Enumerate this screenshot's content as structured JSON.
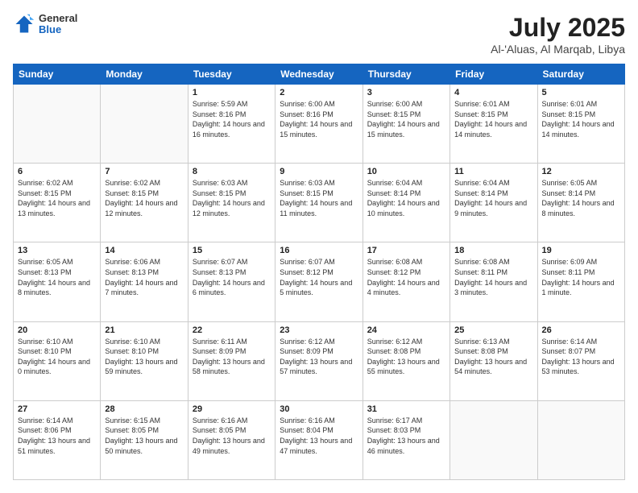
{
  "header": {
    "logo_general": "General",
    "logo_blue": "Blue",
    "month_year": "July 2025",
    "location": "Al-'Aluas, Al Marqab, Libya"
  },
  "days_of_week": [
    "Sunday",
    "Monday",
    "Tuesday",
    "Wednesday",
    "Thursday",
    "Friday",
    "Saturday"
  ],
  "weeks": [
    [
      {
        "day": "",
        "info": ""
      },
      {
        "day": "",
        "info": ""
      },
      {
        "day": "1",
        "info": "Sunrise: 5:59 AM\nSunset: 8:16 PM\nDaylight: 14 hours and 16 minutes."
      },
      {
        "day": "2",
        "info": "Sunrise: 6:00 AM\nSunset: 8:16 PM\nDaylight: 14 hours and 15 minutes."
      },
      {
        "day": "3",
        "info": "Sunrise: 6:00 AM\nSunset: 8:15 PM\nDaylight: 14 hours and 15 minutes."
      },
      {
        "day": "4",
        "info": "Sunrise: 6:01 AM\nSunset: 8:15 PM\nDaylight: 14 hours and 14 minutes."
      },
      {
        "day": "5",
        "info": "Sunrise: 6:01 AM\nSunset: 8:15 PM\nDaylight: 14 hours and 14 minutes."
      }
    ],
    [
      {
        "day": "6",
        "info": "Sunrise: 6:02 AM\nSunset: 8:15 PM\nDaylight: 14 hours and 13 minutes."
      },
      {
        "day": "7",
        "info": "Sunrise: 6:02 AM\nSunset: 8:15 PM\nDaylight: 14 hours and 12 minutes."
      },
      {
        "day": "8",
        "info": "Sunrise: 6:03 AM\nSunset: 8:15 PM\nDaylight: 14 hours and 12 minutes."
      },
      {
        "day": "9",
        "info": "Sunrise: 6:03 AM\nSunset: 8:15 PM\nDaylight: 14 hours and 11 minutes."
      },
      {
        "day": "10",
        "info": "Sunrise: 6:04 AM\nSunset: 8:14 PM\nDaylight: 14 hours and 10 minutes."
      },
      {
        "day": "11",
        "info": "Sunrise: 6:04 AM\nSunset: 8:14 PM\nDaylight: 14 hours and 9 minutes."
      },
      {
        "day": "12",
        "info": "Sunrise: 6:05 AM\nSunset: 8:14 PM\nDaylight: 14 hours and 8 minutes."
      }
    ],
    [
      {
        "day": "13",
        "info": "Sunrise: 6:05 AM\nSunset: 8:13 PM\nDaylight: 14 hours and 8 minutes."
      },
      {
        "day": "14",
        "info": "Sunrise: 6:06 AM\nSunset: 8:13 PM\nDaylight: 14 hours and 7 minutes."
      },
      {
        "day": "15",
        "info": "Sunrise: 6:07 AM\nSunset: 8:13 PM\nDaylight: 14 hours and 6 minutes."
      },
      {
        "day": "16",
        "info": "Sunrise: 6:07 AM\nSunset: 8:12 PM\nDaylight: 14 hours and 5 minutes."
      },
      {
        "day": "17",
        "info": "Sunrise: 6:08 AM\nSunset: 8:12 PM\nDaylight: 14 hours and 4 minutes."
      },
      {
        "day": "18",
        "info": "Sunrise: 6:08 AM\nSunset: 8:11 PM\nDaylight: 14 hours and 3 minutes."
      },
      {
        "day": "19",
        "info": "Sunrise: 6:09 AM\nSunset: 8:11 PM\nDaylight: 14 hours and 1 minute."
      }
    ],
    [
      {
        "day": "20",
        "info": "Sunrise: 6:10 AM\nSunset: 8:10 PM\nDaylight: 14 hours and 0 minutes."
      },
      {
        "day": "21",
        "info": "Sunrise: 6:10 AM\nSunset: 8:10 PM\nDaylight: 13 hours and 59 minutes."
      },
      {
        "day": "22",
        "info": "Sunrise: 6:11 AM\nSunset: 8:09 PM\nDaylight: 13 hours and 58 minutes."
      },
      {
        "day": "23",
        "info": "Sunrise: 6:12 AM\nSunset: 8:09 PM\nDaylight: 13 hours and 57 minutes."
      },
      {
        "day": "24",
        "info": "Sunrise: 6:12 AM\nSunset: 8:08 PM\nDaylight: 13 hours and 55 minutes."
      },
      {
        "day": "25",
        "info": "Sunrise: 6:13 AM\nSunset: 8:08 PM\nDaylight: 13 hours and 54 minutes."
      },
      {
        "day": "26",
        "info": "Sunrise: 6:14 AM\nSunset: 8:07 PM\nDaylight: 13 hours and 53 minutes."
      }
    ],
    [
      {
        "day": "27",
        "info": "Sunrise: 6:14 AM\nSunset: 8:06 PM\nDaylight: 13 hours and 51 minutes."
      },
      {
        "day": "28",
        "info": "Sunrise: 6:15 AM\nSunset: 8:05 PM\nDaylight: 13 hours and 50 minutes."
      },
      {
        "day": "29",
        "info": "Sunrise: 6:16 AM\nSunset: 8:05 PM\nDaylight: 13 hours and 49 minutes."
      },
      {
        "day": "30",
        "info": "Sunrise: 6:16 AM\nSunset: 8:04 PM\nDaylight: 13 hours and 47 minutes."
      },
      {
        "day": "31",
        "info": "Sunrise: 6:17 AM\nSunset: 8:03 PM\nDaylight: 13 hours and 46 minutes."
      },
      {
        "day": "",
        "info": ""
      },
      {
        "day": "",
        "info": ""
      }
    ]
  ]
}
